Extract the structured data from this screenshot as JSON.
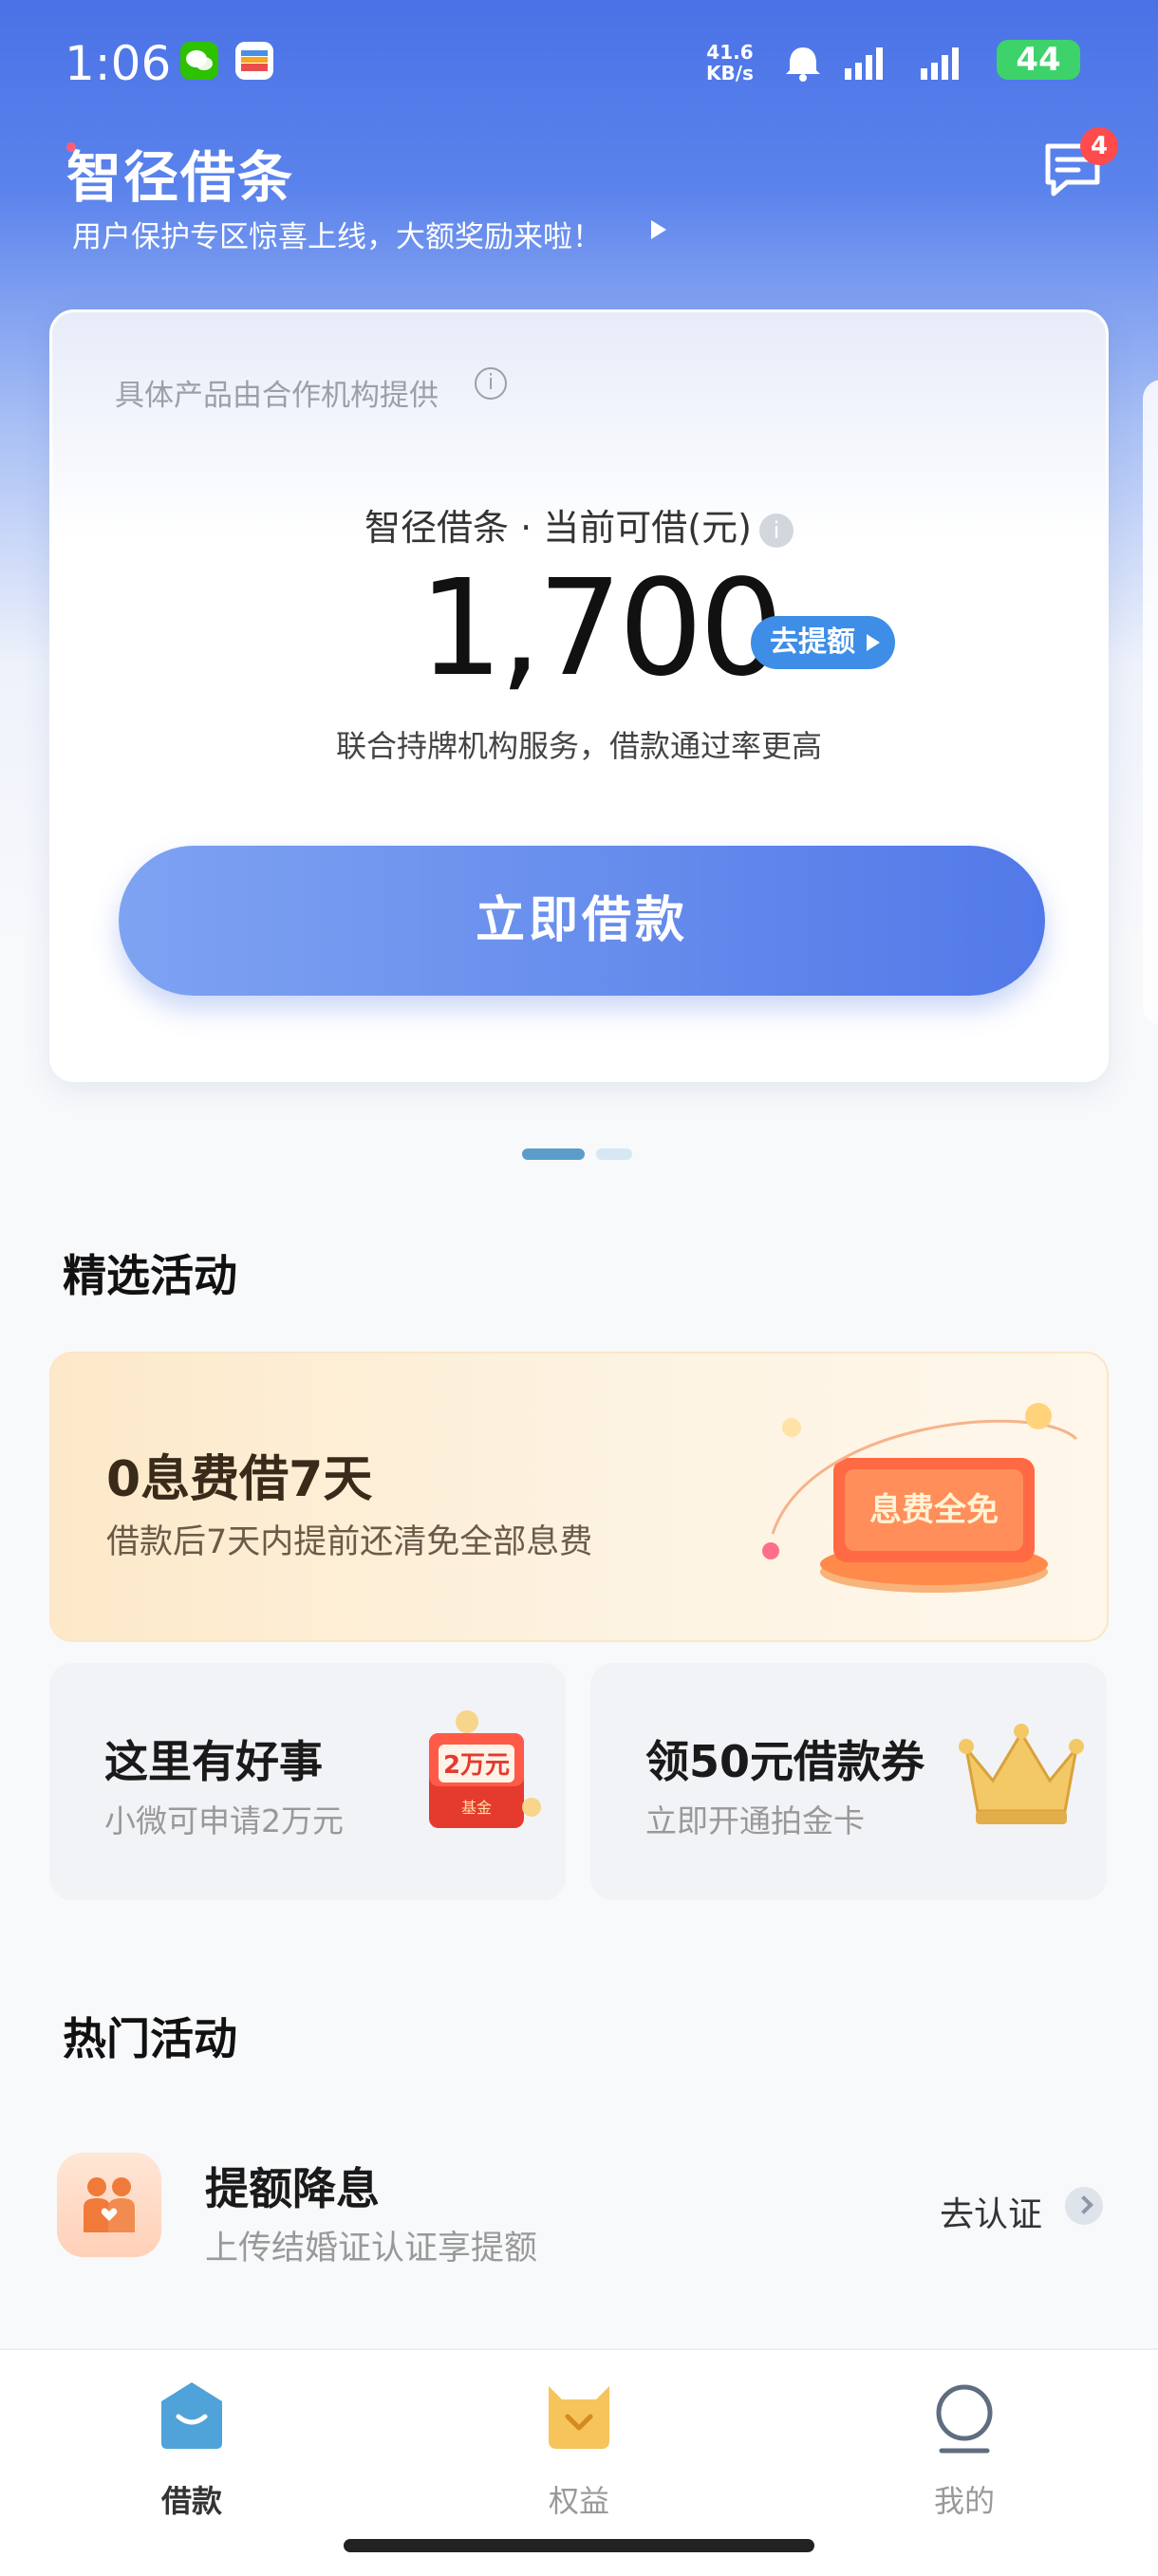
{
  "status_bar": {
    "time": "1:06",
    "net_speed_value": "41.6",
    "net_speed_unit": "KB/s",
    "battery": "44"
  },
  "header": {
    "brand": "智径借条",
    "subtitle": "用户保护专区惊喜上线，大额奖励来啦！",
    "message_count": "4"
  },
  "credit_card": {
    "provider_note": "具体产品由合作机构提供",
    "available_label": "智径借条 · 当前可借(元)",
    "amount": "1,700",
    "raise_label": "去提额",
    "note": "联合持牌机构服务，借款通过率更高",
    "borrow_button": "立即借款"
  },
  "featured": {
    "title": "精选活动",
    "main_promo": {
      "title": "0息费借7天",
      "desc": "借款后7天内提前还清免全部息费",
      "art_text": "息费全免"
    },
    "cards": [
      {
        "title": "这里有好事",
        "desc": "小微可申请2万元",
        "art_text": "2万元",
        "art_sub": "基金"
      },
      {
        "title": "领50元借款券",
        "desc": "立即开通拍金卡"
      }
    ]
  },
  "hot": {
    "title": "热门活动",
    "items": [
      {
        "title": "提额降息",
        "desc": "上传结婚证认证享提额",
        "action": "去认证"
      }
    ]
  },
  "tabbar": {
    "tabs": [
      {
        "label": "借款",
        "icon": "home-icon"
      },
      {
        "label": "权益",
        "icon": "benefits-icon"
      },
      {
        "label": "我的",
        "icon": "profile-icon"
      }
    ]
  },
  "colors": {
    "primary": "#5279e8",
    "accent_blue": "#3e8de6",
    "badge_red": "#ff4b4b",
    "battery_green": "#3dd36a"
  }
}
